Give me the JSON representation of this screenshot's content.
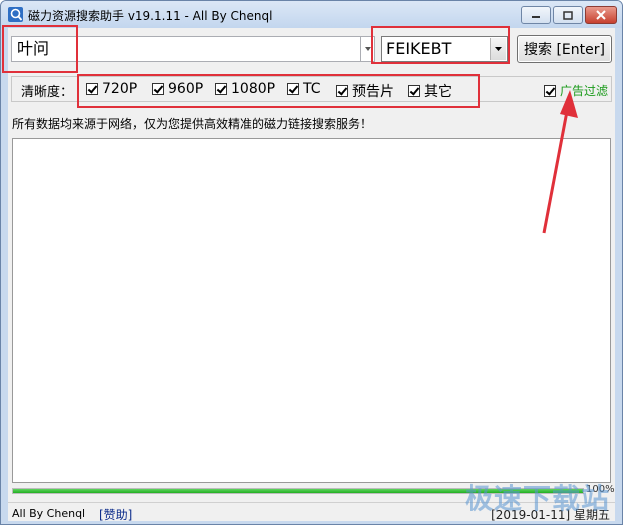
{
  "window": {
    "title": "磁力资源搜索助手 v19.1.11 - All By Chenql"
  },
  "search": {
    "query": "叶问",
    "source_value": "FEIKEBT",
    "button_label": "搜索 [Enter]"
  },
  "filters": {
    "label": "清晰度：",
    "options": [
      {
        "label": "720P",
        "checked": true
      },
      {
        "label": "960P",
        "checked": true
      },
      {
        "label": "1080P",
        "checked": true
      },
      {
        "label": "TC",
        "checked": true
      },
      {
        "label": "预告片",
        "checked": true
      },
      {
        "label": "其它",
        "checked": true
      }
    ],
    "ad_filter": {
      "label": "广告过滤",
      "checked": true
    }
  },
  "notice": "所有数据均来源于网络，仅为您提供高效精准的磁力链接搜索服务！",
  "progress": {
    "percent": 100,
    "text": "100%"
  },
  "status": {
    "author": "All By Chenql",
    "donate": "[赞助]",
    "date": "[2019-01-11] 星期五"
  },
  "watermark": "极速下载站",
  "colors": {
    "annotation": "#e0303a",
    "ad_filter_text": "#1a9a1a",
    "progress": "#22b022"
  }
}
